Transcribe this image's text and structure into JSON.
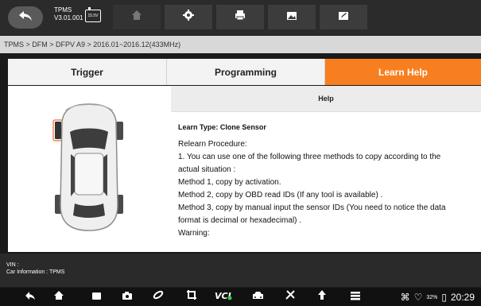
{
  "app": {
    "name": "TPMS",
    "version": "V3.01.001",
    "battery": "15.5V"
  },
  "toolbar": {
    "buttons": [
      "back",
      "home",
      "settings",
      "print",
      "screenshot",
      "edit"
    ]
  },
  "breadcrumb": "TPMS > DFM > DFPV A9 > 2016.01~2016.12(433MHz)",
  "tabs": [
    {
      "label": "Trigger",
      "active": false
    },
    {
      "label": "Programming",
      "active": false
    },
    {
      "label": "Learn Help",
      "active": true
    }
  ],
  "help": {
    "title": "Help",
    "learn_type": "Learn Type:  Clone Sensor",
    "lines": [
      "Relearn Procedure:",
      "1. You can use one of the following three methods to copy according to the",
      "actual situation :",
      "Method 1, copy by activation.",
      "Method 2, copy by OBD read IDs (If any tool is available) .",
      "Method 3, copy by manual input the sensor IDs (You need to notice the data",
      "format is decimal or hexadecimal) .",
      "Warning:"
    ]
  },
  "vehicle": {
    "vin": "VIN :",
    "car_information": "Car Information : TPMS"
  },
  "statusbar": {
    "battery": "32%",
    "time": "20:29"
  },
  "colors": {
    "accent": "#f87f1f",
    "tire_highlight": "#f06a2a"
  }
}
